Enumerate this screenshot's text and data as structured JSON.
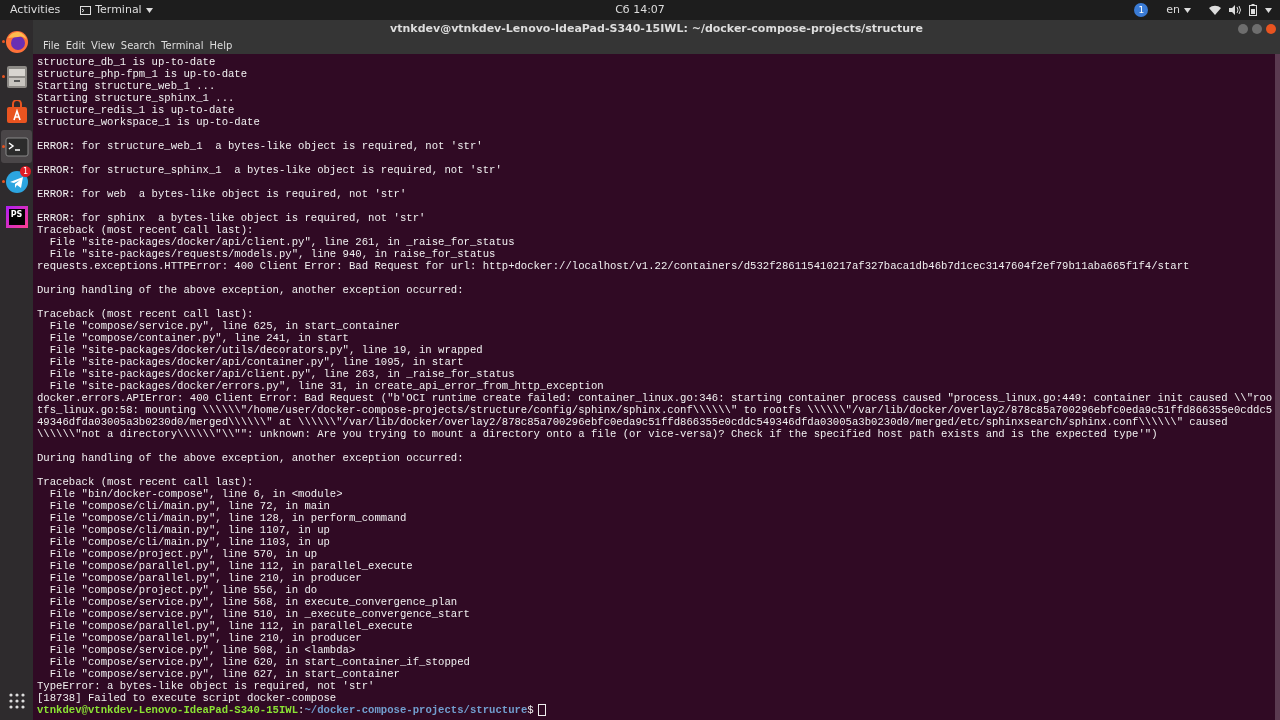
{
  "top_bar": {
    "activities": "Activities",
    "app_menu": "Terminal",
    "clock": "Сб 14:07",
    "notification_count": "1",
    "language": "en"
  },
  "dock": {
    "items": [
      {
        "kind": "firefox",
        "running": true,
        "selected": false
      },
      {
        "kind": "files",
        "running": true,
        "selected": false
      },
      {
        "kind": "software",
        "running": false,
        "selected": false
      },
      {
        "kind": "terminal",
        "running": true,
        "selected": true
      },
      {
        "kind": "telegram",
        "running": true,
        "selected": false,
        "badge": "1"
      },
      {
        "kind": "phpstorm",
        "running": false,
        "selected": false,
        "label": "PS"
      }
    ]
  },
  "window": {
    "title": "vtnkdev@vtnkdev-Lenovo-IdeaPad-S340-15IWL: ~/docker-compose-projects/structure",
    "menu": [
      "File",
      "Edit",
      "View",
      "Search",
      "Terminal",
      "Help"
    ]
  },
  "terminal": {
    "blocks": [
      [
        "structure_db_1 is up-to-date",
        "structure_php-fpm_1 is up-to-date",
        "Starting structure_web_1 ...",
        "Starting structure_sphinx_1 ...",
        "structure_redis_1 is up-to-date",
        "structure_workspace_1 is up-to-date"
      ],
      [
        "ERROR: for structure_web_1  a bytes-like object is required, not 'str'"
      ],
      [
        "ERROR: for structure_sphinx_1  a bytes-like object is required, not 'str'"
      ],
      [
        "ERROR: for web  a bytes-like object is required, not 'str'"
      ],
      [
        "ERROR: for sphinx  a bytes-like object is required, not 'str'",
        "Traceback (most recent call last):",
        "  File \"site-packages/docker/api/client.py\", line 261, in _raise_for_status",
        "  File \"site-packages/requests/models.py\", line 940, in raise_for_status",
        "requests.exceptions.HTTPError: 400 Client Error: Bad Request for url: http+docker://localhost/v1.22/containers/d532f286115410217af327baca1db46b7d1cec3147604f2ef79b11aba665f1f4/start"
      ],
      [
        "During handling of the above exception, another exception occurred:"
      ],
      [
        "Traceback (most recent call last):",
        "  File \"compose/service.py\", line 625, in start_container",
        "  File \"compose/container.py\", line 241, in start",
        "  File \"site-packages/docker/utils/decorators.py\", line 19, in wrapped",
        "  File \"site-packages/docker/api/container.py\", line 1095, in start",
        "  File \"site-packages/docker/api/client.py\", line 263, in _raise_for_status",
        "  File \"site-packages/docker/errors.py\", line 31, in create_api_error_from_http_exception",
        "docker.errors.APIError: 400 Client Error: Bad Request (\"b'OCI runtime create failed: container_linux.go:346: starting container process caused \"process_linux.go:449: container init caused \\\\\"rootfs_linux.go:58: mounting \\\\\\\\\\\\\"/home/user/docker-compose-projects/structure/config/sphinx/sphinx.conf\\\\\\\\\\\\\" to rootfs \\\\\\\\\\\\\"/var/lib/docker/overlay2/878c85a700296ebfc0eda9c51ffd866355e0cddc549346dfda03005a3b0230d0/merged\\\\\\\\\\\\\" at \\\\\\\\\\\\\"/var/lib/docker/overlay2/878c85a700296ebfc0eda9c51ffd866355e0cddc549346dfda03005a3b0230d0/merged/etc/sphinxsearch/sphinx.conf\\\\\\\\\\\\\" caused \\\\\\\\\\\\\"not a directory\\\\\\\\\\\\\"\\\\\"\": unknown: Are you trying to mount a directory onto a file (or vice-versa)? Check if the specified host path exists and is the expected type'\")"
      ],
      [
        "During handling of the above exception, another exception occurred:"
      ],
      [
        "Traceback (most recent call last):",
        "  File \"bin/docker-compose\", line 6, in <module>",
        "  File \"compose/cli/main.py\", line 72, in main",
        "  File \"compose/cli/main.py\", line 128, in perform_command",
        "  File \"compose/cli/main.py\", line 1107, in up",
        "  File \"compose/cli/main.py\", line 1103, in up",
        "  File \"compose/project.py\", line 570, in up",
        "  File \"compose/parallel.py\", line 112, in parallel_execute",
        "  File \"compose/parallel.py\", line 210, in producer",
        "  File \"compose/project.py\", line 556, in do",
        "  File \"compose/service.py\", line 568, in execute_convergence_plan",
        "  File \"compose/service.py\", line 510, in _execute_convergence_start",
        "  File \"compose/parallel.py\", line 112, in parallel_execute",
        "  File \"compose/parallel.py\", line 210, in producer",
        "  File \"compose/service.py\", line 508, in <lambda>",
        "  File \"compose/service.py\", line 620, in start_container_if_stopped",
        "  File \"compose/service.py\", line 627, in start_container",
        "TypeError: a bytes-like object is required, not 'str'",
        "[18738] Failed to execute script docker-compose"
      ]
    ],
    "prompt": {
      "user_host": "vtnkdev@vtnkdev-Lenovo-IdeaPad-S340-15IWL",
      "separator": ":",
      "path": "~/docker-compose-projects/structure",
      "symbol": "$"
    }
  }
}
